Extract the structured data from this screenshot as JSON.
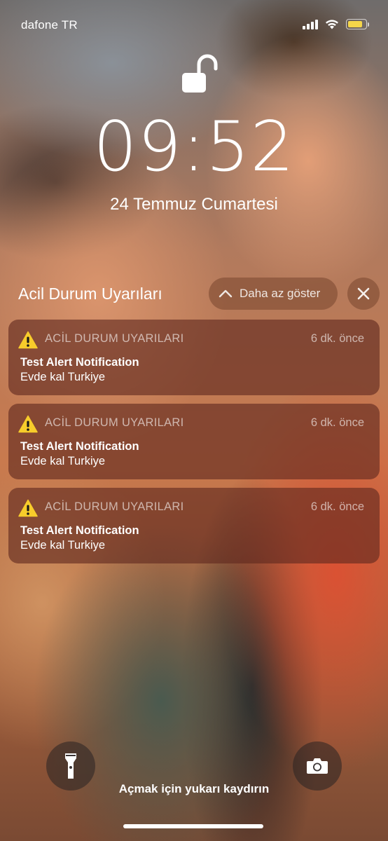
{
  "status_bar": {
    "carrier": "dafone TR",
    "signal_bars": 4,
    "wifi_icon": "wifi-icon",
    "battery_icon": "battery-icon",
    "battery_level": 0.85,
    "battery_color": "#f5d64a"
  },
  "lock": {
    "icon": "unlocked-padlock-icon",
    "state": "unlocked"
  },
  "clock": {
    "time": "09:52",
    "date": "24 Temmuz Cumartesi"
  },
  "notification_group": {
    "title": "Acil Durum Uyarıları",
    "show_less_label": "Daha az göster",
    "show_less_icon": "chevron-up-icon",
    "close_icon": "close-icon",
    "items": [
      {
        "app": "ACİL DURUM UYARILARI",
        "time": "6 dk. önce",
        "title": "Test Alert Notification",
        "body": "Evde kal Turkiye",
        "icon": "warning-icon"
      },
      {
        "app": "ACİL DURUM UYARILARI",
        "time": "6 dk. önce",
        "title": "Test Alert Notification",
        "body": "Evde kal Turkiye",
        "icon": "warning-icon"
      },
      {
        "app": "ACİL DURUM UYARILARI",
        "time": "6 dk. önce",
        "title": "Test Alert Notification",
        "body": "Evde kal Turkiye",
        "icon": "warning-icon"
      }
    ]
  },
  "quick_actions": {
    "flashlight_icon": "flashlight-icon",
    "camera_icon": "camera-icon"
  },
  "swipe_hint": "Açmak için yukarı kaydırın",
  "colors": {
    "warning_yellow": "#f7cc2b",
    "notification_bg": "rgba(95,40,30,0.62)"
  }
}
